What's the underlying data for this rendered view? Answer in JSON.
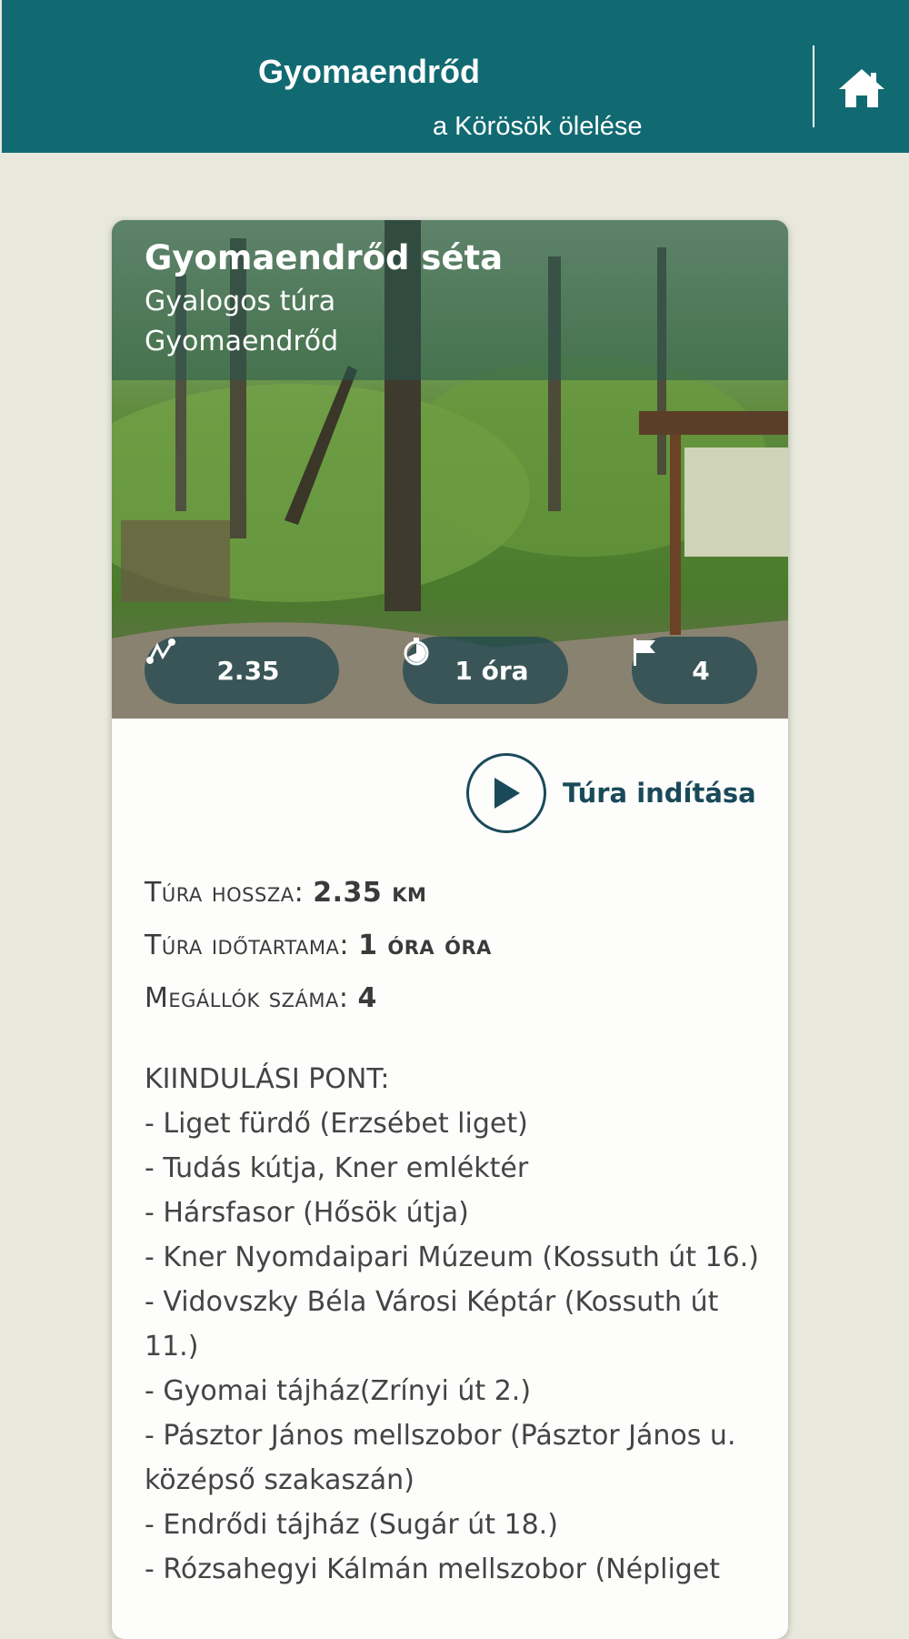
{
  "header": {
    "title": "Gyomaendrőd",
    "subtitle": "a Körösök ölelése",
    "home_icon": "home-icon",
    "color": "#116a72"
  },
  "tour": {
    "title": "Gyomaendrőd séta",
    "type": "Gyalogos túra",
    "location": "Gyomaendrőd",
    "badges": {
      "distance": "2.35",
      "duration": "1 óra",
      "stops": "4"
    },
    "start_label": "Túra indítása",
    "stats": {
      "length_label": "Túra hossza:",
      "length_value": "2.35 km",
      "duration_label": "Túra időtartama:",
      "duration_value": "1 óra óra",
      "stops_label": "Megállók száma:",
      "stops_value": "4"
    },
    "description": {
      "heading": "KIINDULÁSI PONT:",
      "items": [
        "- Liget fürdő (Erzsébet liget)",
        "- Tudás kútja, Kner emléktér",
        "- Hársfasor (Hősök útja)",
        "- Kner Nyomdaipari Múzeum (Kossuth út 16.)",
        "- Vidovszky Béla Városi Képtár (Kossuth út 11.)",
        "- Gyomai tájház(Zrínyi út 2.)",
        "- Pásztor János mellszobor (Pásztor János u. középső szakaszán)",
        "- Endrődi tájház (Sugár út 18.)",
        "- Rózsahegyi Kálmán mellszobor (Népliget"
      ]
    }
  }
}
